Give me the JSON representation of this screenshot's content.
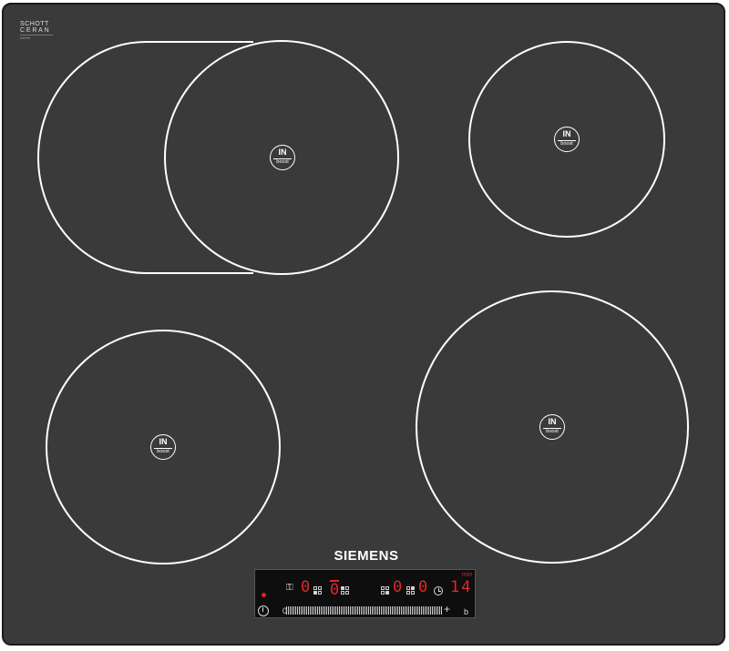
{
  "brand": {
    "glass_logo_line1": "SCHOTT",
    "glass_logo_line2": "CERAN",
    "glass_logo_line3": "▪▪▪▪▪▪▪▪",
    "name": "SIEMENS"
  },
  "zones": [
    {
      "id": "front-left",
      "badge_top": "IN",
      "badge_bottom": "boost"
    },
    {
      "id": "rear-left-flex",
      "badge_top": "IN",
      "badge_bottom": "boost"
    },
    {
      "id": "rear-right",
      "badge_top": "IN",
      "badge_bottom": "boost"
    },
    {
      "id": "front-right",
      "badge_top": "IN",
      "badge_bottom": "boost"
    }
  ],
  "control_panel": {
    "display_zone_1": "0",
    "display_zone_2": "0",
    "display_zone_3": "0",
    "display_zone_4": "0",
    "timer_display": "14",
    "timer_unit": "min",
    "slider_min_label": "0",
    "slider_plus_label": "+",
    "slider_end_label": "b",
    "wipe_protect_symbol": "⚿",
    "colors": {
      "display": "#e02828",
      "panel_bg": "#0e0e0e",
      "glass": "#3a3a3a"
    }
  }
}
